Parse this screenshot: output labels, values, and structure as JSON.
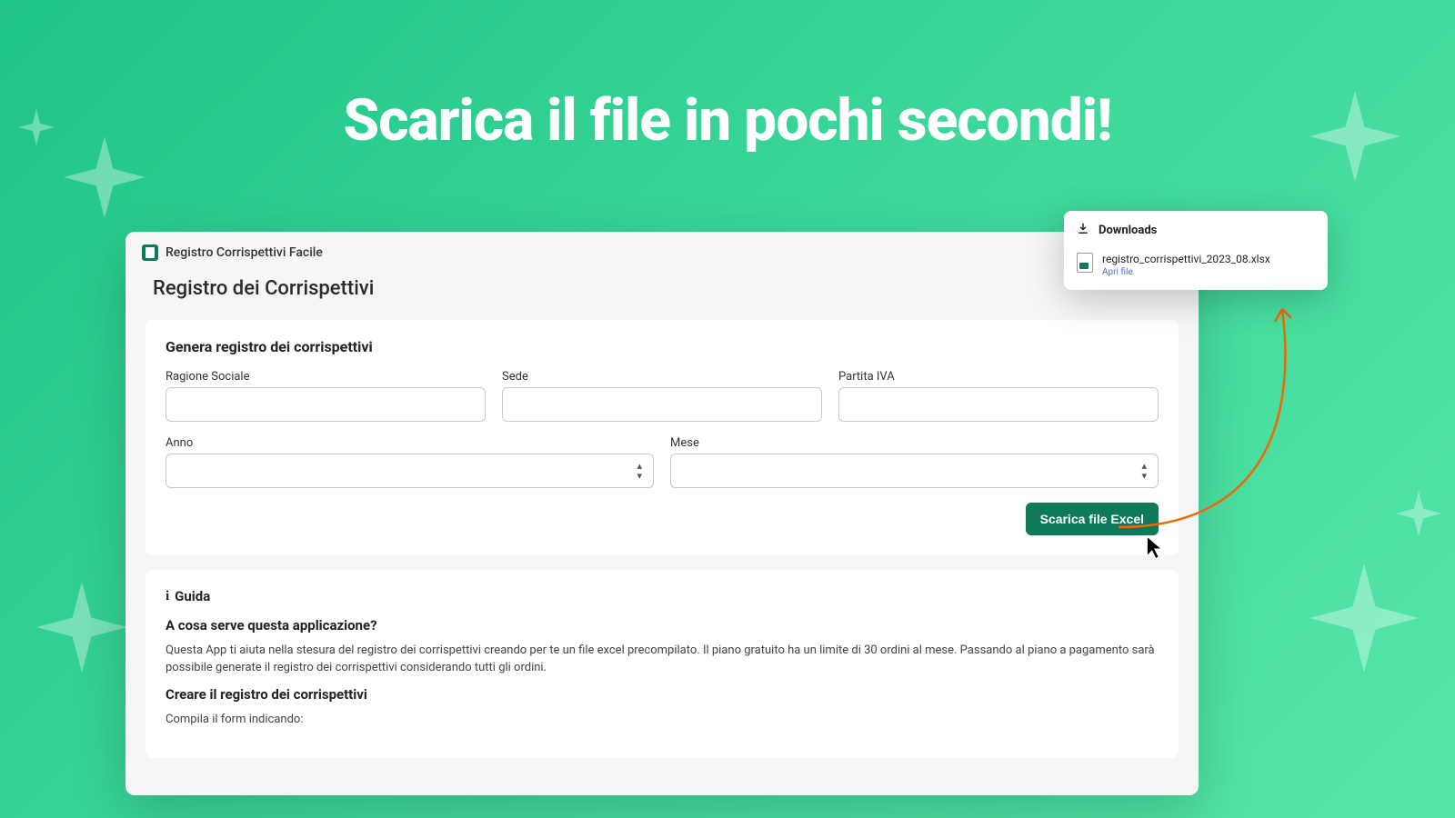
{
  "hero_title": "Scarica il file in pochi secondi!",
  "app": {
    "name": "Registro Corrispettivi Facile",
    "page_title": "Registro dei Corrispettivi"
  },
  "form": {
    "card_title": "Genera registro dei corrispettivi",
    "labels": {
      "ragione_sociale": "Ragione Sociale",
      "sede": "Sede",
      "partita_iva": "Partita IVA",
      "anno": "Anno",
      "mese": "Mese"
    },
    "values": {
      "ragione_sociale": "",
      "sede": "",
      "partita_iva": "",
      "anno": "",
      "mese": ""
    },
    "download_button": "Scarica file Excel"
  },
  "guide": {
    "heading": "Guida",
    "section1_title": "A cosa serve questa applicazione?",
    "section1_body": "Questa App ti aiuta nella stesura del registro dei corrispettivi creando per te un file excel precompilato. Il piano gratuito ha un limite di 30 ordini al mese. Passando al piano a pagamento sarà possibile generate il registro dei corrispettivi considerando tutti gli ordini.",
    "section2_title": "Creare il registro dei corrispettivi",
    "section2_body": "Compila il form indicando:"
  },
  "downloads": {
    "label": "Downloads",
    "file_name": "registro_corrispettivi_2023_08.xlsx",
    "file_action": "Apri file"
  },
  "colors": {
    "accent": "#0f7a5a",
    "bg_gradient_start": "#1fc487",
    "bg_gradient_end": "#56e6a8"
  }
}
